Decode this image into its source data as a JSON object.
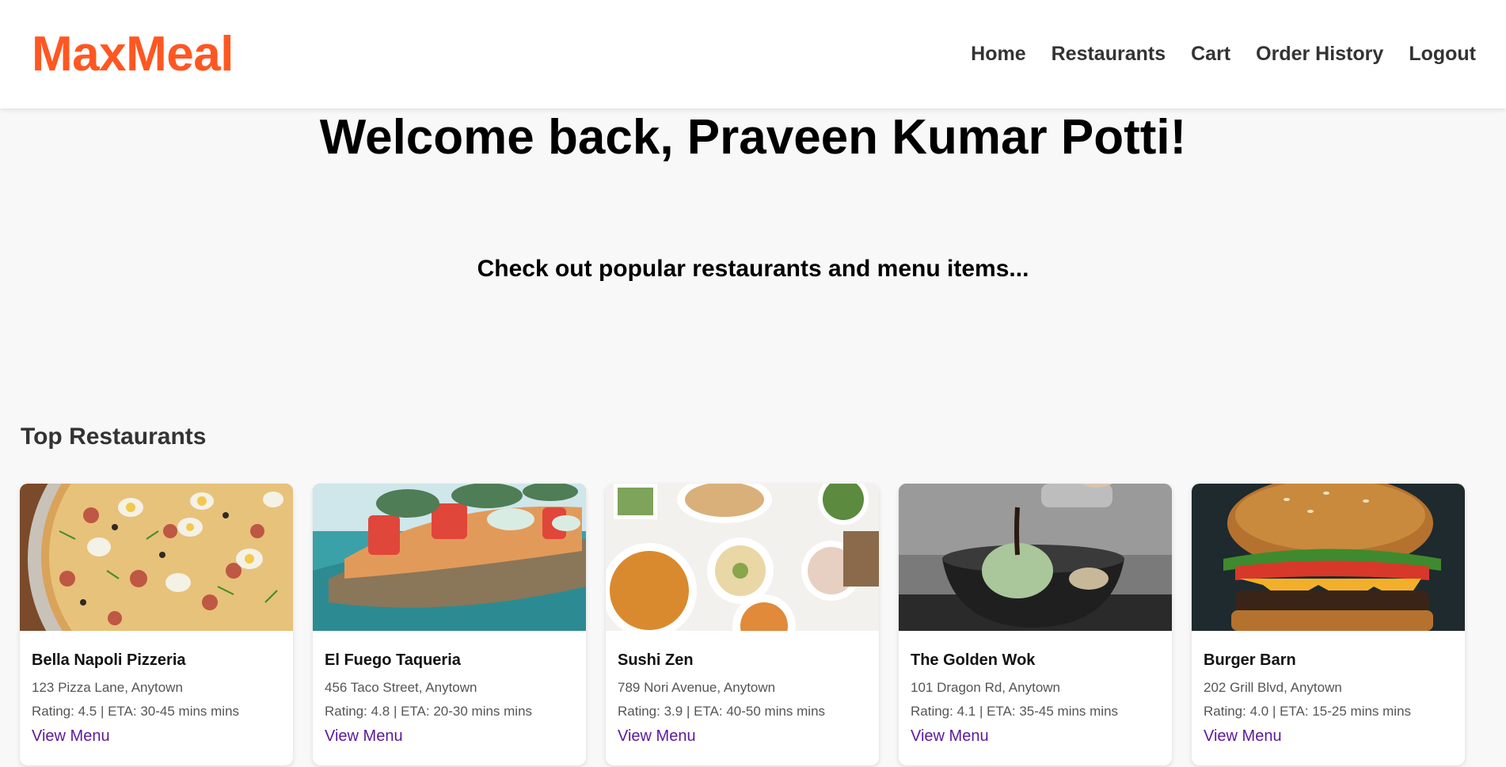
{
  "brand": {
    "name": "MaxMeal",
    "color": "#ff5722"
  },
  "nav": {
    "items": [
      {
        "label": "Home"
      },
      {
        "label": "Restaurants"
      },
      {
        "label": "Cart"
      },
      {
        "label": "Order History"
      },
      {
        "label": "Logout"
      }
    ]
  },
  "hero": {
    "welcome": "Welcome back, Praveen Kumar Potti!",
    "tagline": "Check out popular restaurants and menu items..."
  },
  "top_restaurants": {
    "title": "Top Restaurants",
    "link_color": "#5b1a9a",
    "cards": [
      {
        "name": "Bella Napoli Pizzeria",
        "address": "123 Pizza Lane, Anytown",
        "rating_text": "Rating: 4.5 | ETA: 30-45 mins mins",
        "link": "View Menu",
        "image": "pizza-photo"
      },
      {
        "name": "El Fuego Taqueria",
        "address": "456 Taco Street, Anytown",
        "rating_text": "Rating: 4.8 | ETA: 20-30 mins mins",
        "link": "View Menu",
        "image": "taco-photo"
      },
      {
        "name": "Sushi Zen",
        "address": "789 Nori Avenue, Anytown",
        "rating_text": "Rating: 3.9 | ETA: 40-50 mins mins",
        "link": "View Menu",
        "image": "mezze-spread-photo"
      },
      {
        "name": "The Golden Wok",
        "address": "101 Dragon Rd, Anytown",
        "rating_text": "Rating: 4.1 | ETA: 35-45 mins mins",
        "link": "View Menu",
        "image": "dessert-bowl-photo"
      },
      {
        "name": "Burger Barn",
        "address": "202 Grill Blvd, Anytown",
        "rating_text": "Rating: 4.0 | ETA: 15-25 mins mins",
        "link": "View Menu",
        "image": "burger-photo"
      }
    ]
  }
}
